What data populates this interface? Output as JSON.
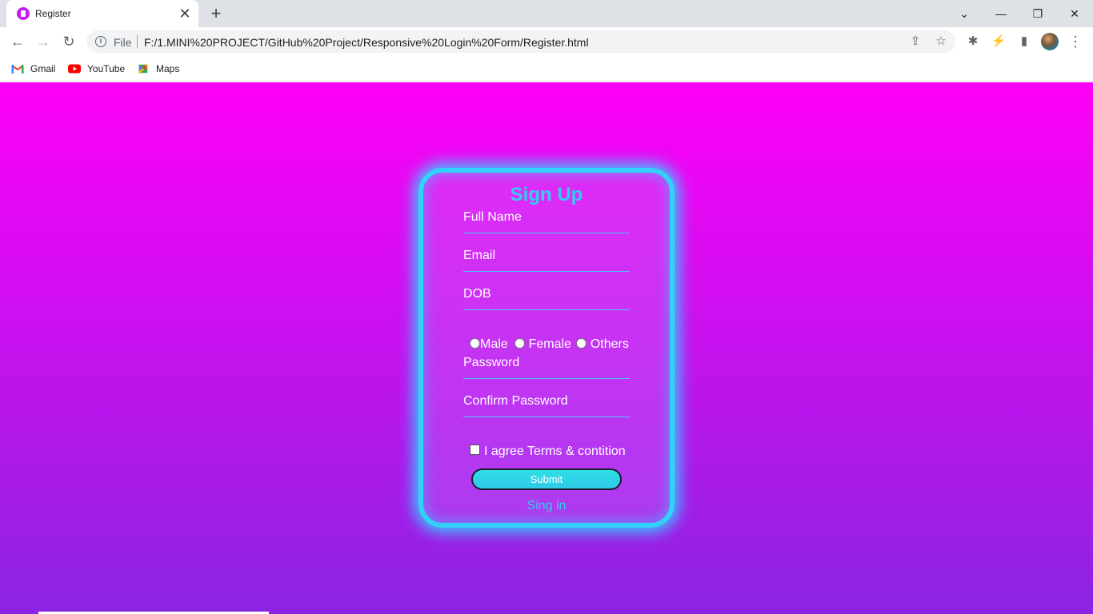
{
  "browser": {
    "tab": {
      "title": "Register",
      "close": "✕"
    },
    "new_tab": "+",
    "window": {
      "tab_search": "⌄",
      "minimize": "—",
      "restore": "❐",
      "close": "✕"
    },
    "nav": {
      "back": "←",
      "forward": "→",
      "reload": "↻"
    },
    "address": {
      "info": "i",
      "scheme_label": "File",
      "url": "F:/1.MINI%20PROJECT/GitHub%20Project/Responsive%20Login%20Form/Register.html",
      "share": "⇪",
      "bookmark": "☆"
    },
    "toolbar": {
      "extensions": "✱",
      "performance": "⚡",
      "side_panel": "▮",
      "menu": "⋮"
    },
    "bookmarks": [
      {
        "label": "Gmail",
        "icon": "gmail-icon"
      },
      {
        "label": "YouTube",
        "icon": "youtube-icon"
      },
      {
        "label": "Maps",
        "icon": "maps-icon"
      }
    ]
  },
  "form": {
    "title": "Sign Up",
    "fields": {
      "full_name": "Full Name",
      "email": "Email",
      "dob": "DOB",
      "password": "Password",
      "confirm_password": "Confirm Password"
    },
    "gender": {
      "male": "Male",
      "female": "Female",
      "others": "Others"
    },
    "terms": "I agree Terms & contition",
    "submit": "Submit",
    "signin": "Sing in"
  },
  "colors": {
    "page_gradient_top": "#ff00f7",
    "page_gradient_bottom": "#8b24e4",
    "card_border": "#32d2f8",
    "accent_text": "#33ccf0",
    "button_fill": "#2fd6e8"
  }
}
